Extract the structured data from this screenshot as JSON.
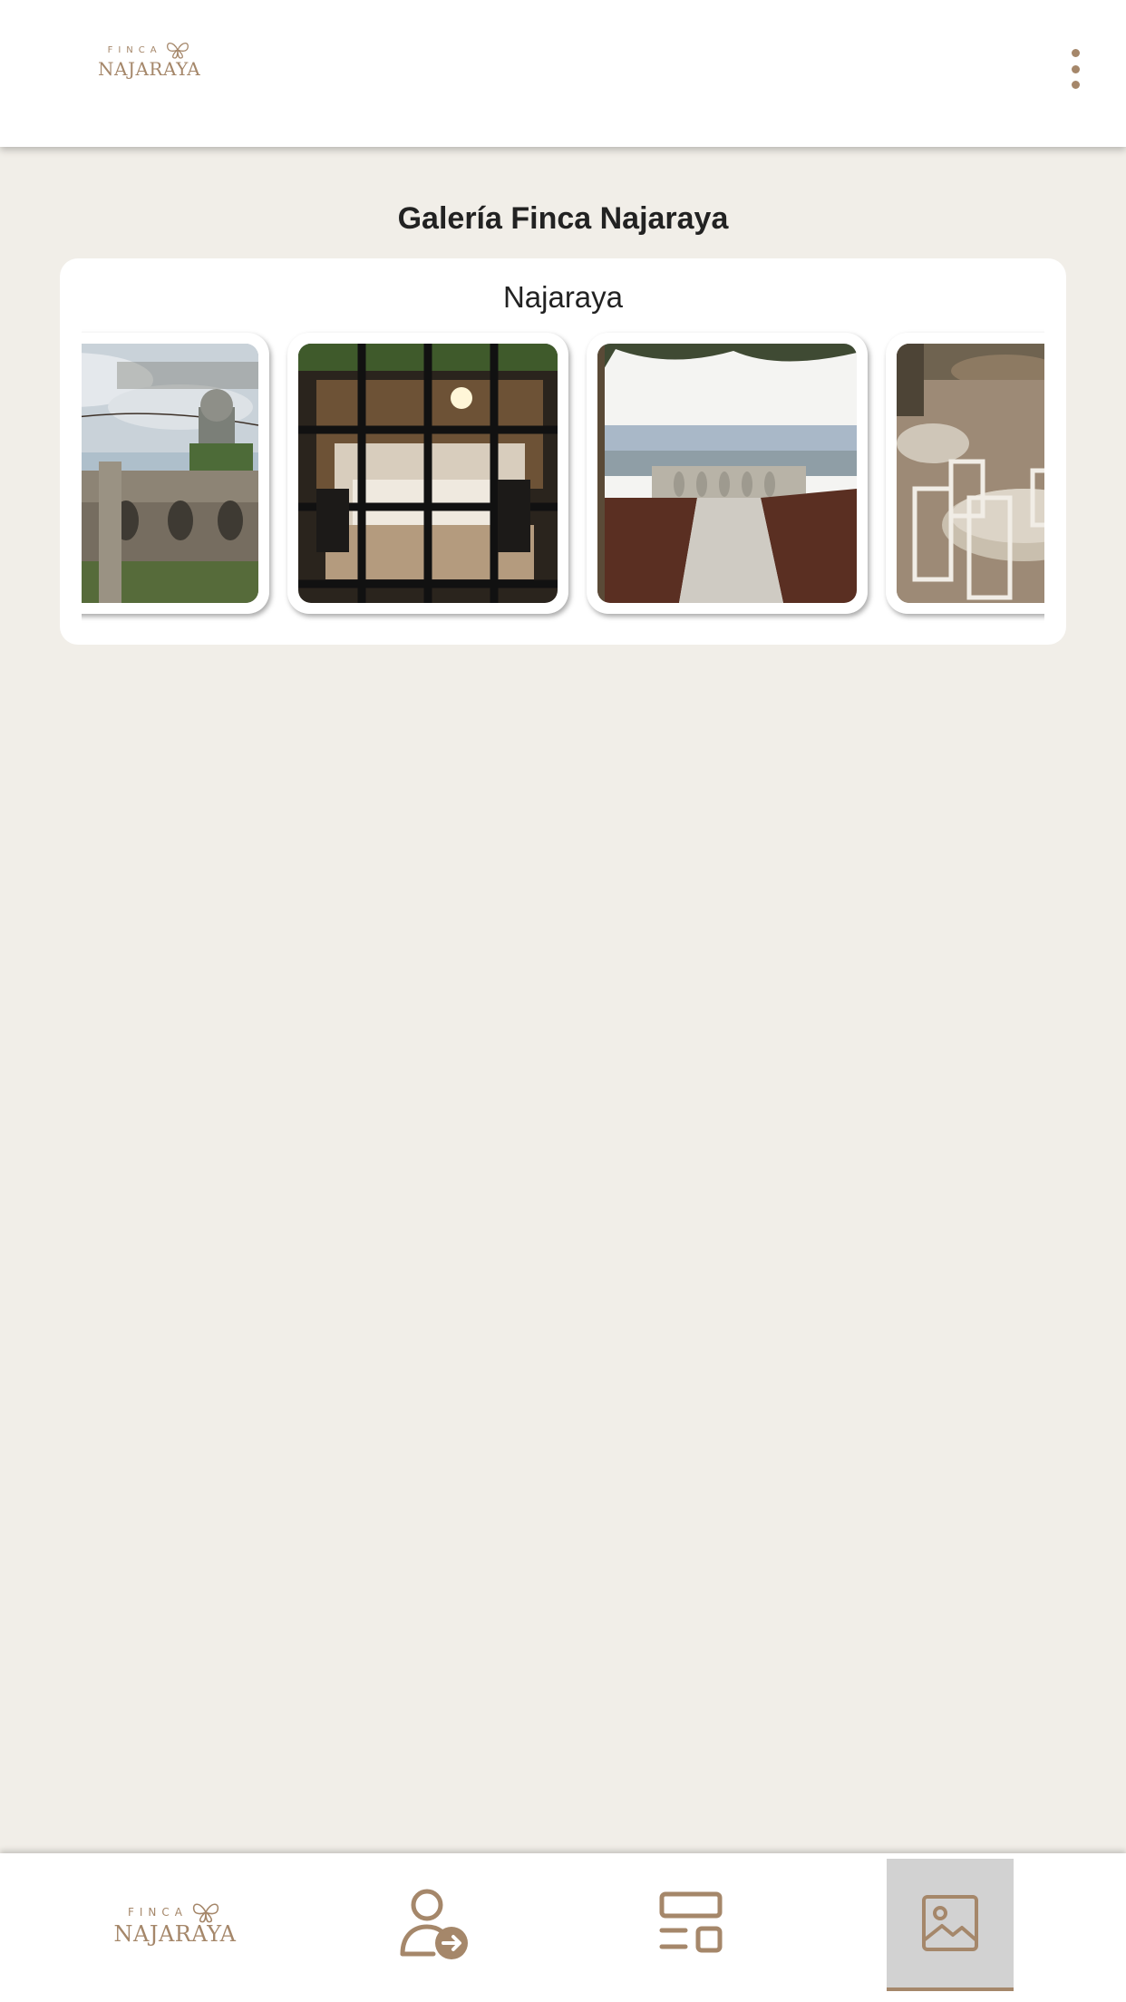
{
  "header": {
    "logo": {
      "finca": "FINCA",
      "name": "NAJARAYA"
    },
    "menu_icon": "more-vertical-icon"
  },
  "main": {
    "title": "Galería Finca Najaraya",
    "gallery": {
      "name": "Najaraya",
      "photos": [
        {
          "subject": "stone-balustrade-birdcage-photo"
        },
        {
          "subject": "dining-hall-through-window-photo"
        },
        {
          "subject": "ceremony-terrace-view-photo"
        },
        {
          "subject": "outdoor-banquet-tables-photo"
        }
      ]
    }
  },
  "bottom_nav": {
    "items": [
      {
        "name": "home",
        "icon": "finca-najaraya-logo",
        "active": false
      },
      {
        "name": "login",
        "icon": "user-arrow-icon",
        "active": false
      },
      {
        "name": "content",
        "icon": "layout-icon",
        "active": false
      },
      {
        "name": "gallery",
        "icon": "image-icon",
        "active": true
      }
    ]
  },
  "colors": {
    "accent": "#a5876a",
    "background": "#f1eee8",
    "surface": "#ffffff",
    "active_tab": "#d2d2d2"
  }
}
